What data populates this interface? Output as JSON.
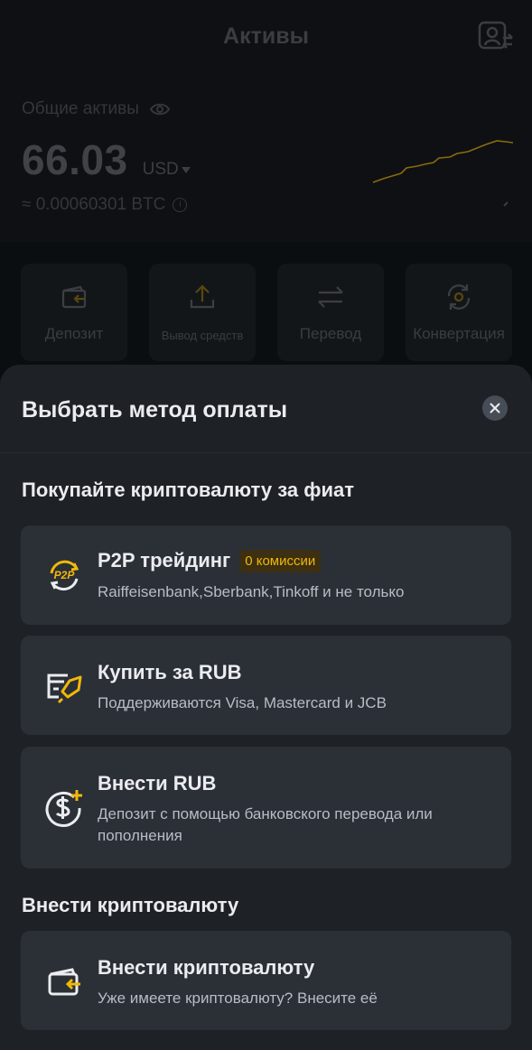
{
  "background": {
    "title": "Активы",
    "total_label": "Общие активы",
    "total_amount": "66.03",
    "currency": "USD",
    "btc_equivalent": "≈ 0.00060301 BTC",
    "actions": [
      {
        "label": "Депозит",
        "icon": "wallet-deposit-icon"
      },
      {
        "label": "Вывод средств",
        "icon": "upload-icon"
      },
      {
        "label": "Перевод",
        "icon": "transfer-arrows-icon"
      },
      {
        "label": "Конвертация",
        "icon": "convert-icon"
      }
    ]
  },
  "sheet": {
    "title": "Выбрать метод оплаты",
    "fiat_section": "Покупайте криптовалюту за фиат",
    "crypto_section": "Внести криптовалюту",
    "methods": [
      {
        "title": "P2P трейдинг",
        "badge": "0 комиссии",
        "desc": "Raiffeisenbank,Sberbank,Tinkoff и не только",
        "icon": "p2p-icon"
      },
      {
        "title": "Купить за RUB",
        "desc": "Поддерживаются Visa, Mastercard и JCB",
        "icon": "card-rocket-icon"
      },
      {
        "title": "Внести RUB",
        "desc": "Депозит с помощью банковского перевода или пополнения",
        "icon": "dollar-plus-icon"
      },
      {
        "title": "Внести криптовалюту",
        "desc": "Уже имеете криптовалюту? Внесите её",
        "icon": "wallet-deposit-icon"
      }
    ]
  },
  "colors": {
    "accent": "#f0b90b",
    "sheet_bg": "#1e2126",
    "card_bg": "#2b2f36",
    "chart_line": "#8a6a10"
  }
}
